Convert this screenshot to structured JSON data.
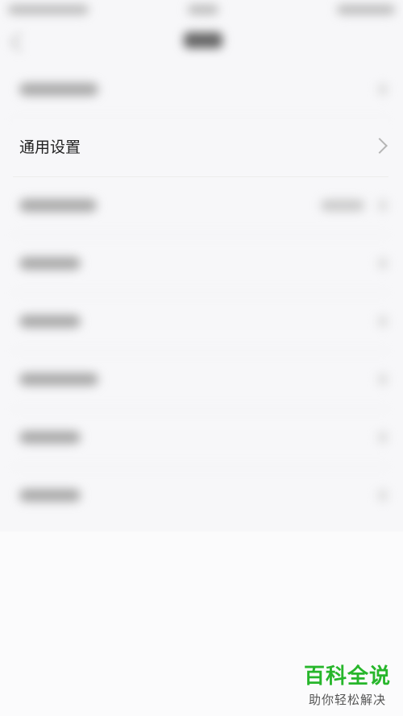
{
  "settings_list": {
    "general_settings_label": "通用设置"
  },
  "watermark": {
    "brand": "百科全说",
    "tagline": "助你轻松解决"
  }
}
